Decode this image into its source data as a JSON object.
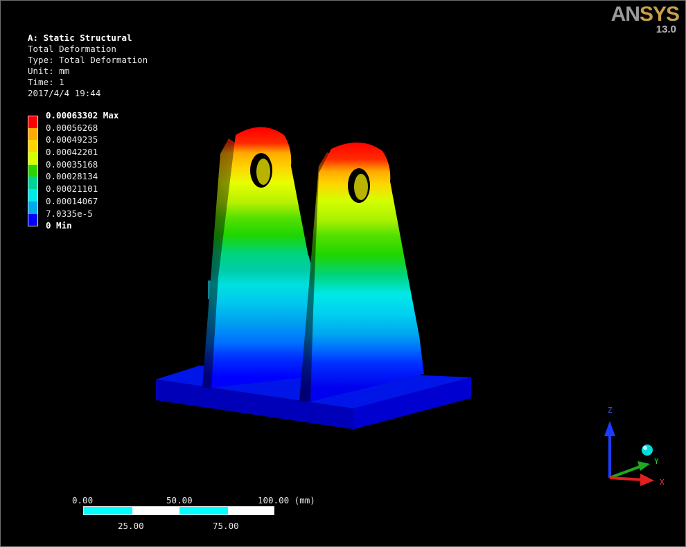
{
  "logo": {
    "brand_an": "AN",
    "brand_sys": "SYS",
    "version": "13.0"
  },
  "info": {
    "title": "A: Static Structural",
    "result": "Total Deformation",
    "type": "Type: Total Deformation",
    "unit": "Unit: mm",
    "time": "Time: 1",
    "timestamp": "2017/4/4 19:44"
  },
  "legend": {
    "labels": [
      "0.00063302 Max",
      "0.00056268",
      "0.00049235",
      "0.00042201",
      "0.00035168",
      "0.00028134",
      "0.00021101",
      "0.00014067",
      "7.0335e-5",
      "0 Min"
    ],
    "colors": [
      "#ff0000",
      "#ffaa00",
      "#ffd500",
      "#d4ff00",
      "#2bd400",
      "#00d49a",
      "#00e8e8",
      "#00a8f0",
      "#0000ff"
    ]
  },
  "scale_bar": {
    "top_labels": [
      "0.00",
      "50.00",
      "100.00 (mm)"
    ],
    "bottom_labels": [
      "25.00",
      "75.00"
    ]
  },
  "triad": {
    "z_label": "Z",
    "y_label": "Y",
    "x_label": "X"
  }
}
